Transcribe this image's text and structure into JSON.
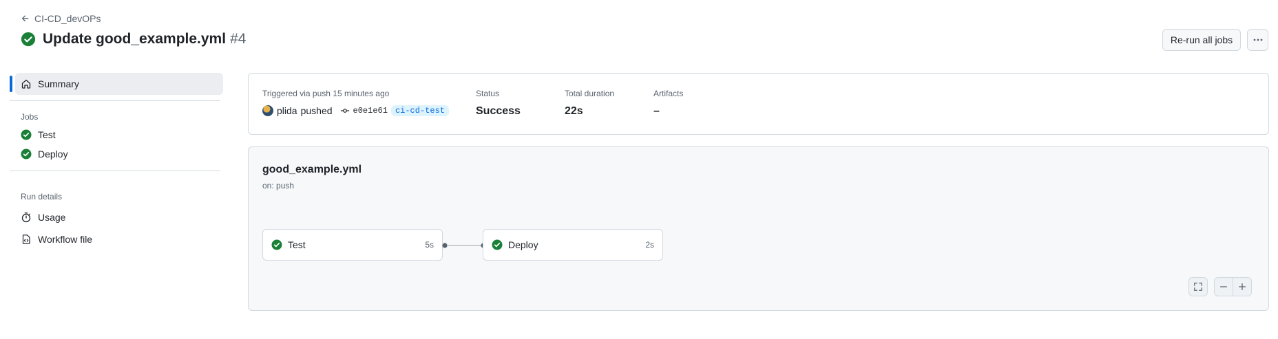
{
  "header": {
    "back_label": "CI-CD_devOPs",
    "title": "Update good_example.yml",
    "run_number": "#4",
    "rerun_label": "Re-run all jobs",
    "more_icon": "kebab-horizontal-icon"
  },
  "sidebar": {
    "summary_label": "Summary",
    "jobs_heading": "Jobs",
    "jobs": [
      {
        "label": "Test",
        "status": "success"
      },
      {
        "label": "Deploy",
        "status": "success"
      }
    ],
    "run_details_heading": "Run details",
    "run_details": [
      {
        "label": "Usage",
        "icon": "stopwatch-icon"
      },
      {
        "label": "Workflow file",
        "icon": "file-code-icon"
      }
    ]
  },
  "summary": {
    "triggered_label": "Triggered via push 15 minutes ago",
    "actor": "plida",
    "action": "pushed",
    "commit_sha": "e0e1e61",
    "branch": "ci-cd-test",
    "status_label": "Status",
    "status_value": "Success",
    "duration_label": "Total duration",
    "duration_value": "22s",
    "artifacts_label": "Artifacts",
    "artifacts_value": "–"
  },
  "graph": {
    "workflow_file": "good_example.yml",
    "trigger": "on: push",
    "jobs": [
      {
        "label": "Test",
        "duration": "5s"
      },
      {
        "label": "Deploy",
        "duration": "2s"
      }
    ]
  },
  "colors": {
    "success": "#1a7f37",
    "accent": "#0969da"
  }
}
